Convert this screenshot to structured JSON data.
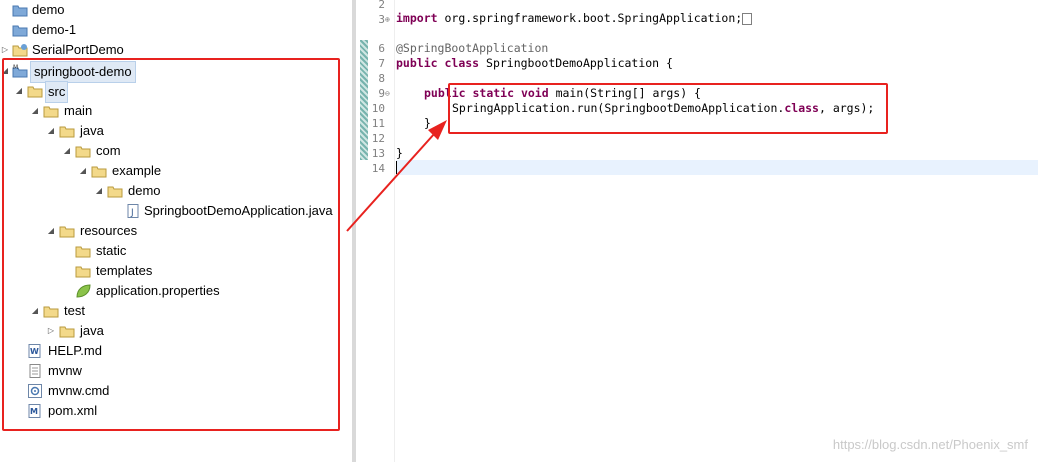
{
  "explorer": {
    "items": [
      {
        "label": "demo",
        "icon": "project-icon"
      },
      {
        "label": "demo-1",
        "icon": "project-icon"
      },
      {
        "label": "SerialPortDemo",
        "icon": "project-icon"
      },
      {
        "label": "springboot-demo",
        "icon": "maven-project-icon"
      },
      {
        "label": "src",
        "icon": "folder-icon"
      },
      {
        "label": "main",
        "icon": "folder-icon"
      },
      {
        "label": "java",
        "icon": "folder-icon"
      },
      {
        "label": "com",
        "icon": "folder-icon"
      },
      {
        "label": "example",
        "icon": "folder-icon"
      },
      {
        "label": "demo",
        "icon": "folder-icon"
      },
      {
        "label": "SpringbootDemoApplication.java",
        "icon": "java-file-icon"
      },
      {
        "label": "resources",
        "icon": "folder-icon"
      },
      {
        "label": "static",
        "icon": "folder-icon"
      },
      {
        "label": "templates",
        "icon": "folder-icon"
      },
      {
        "label": "application.properties",
        "icon": "properties-file-icon"
      },
      {
        "label": "test",
        "icon": "folder-icon"
      },
      {
        "label": "java",
        "icon": "folder-icon"
      },
      {
        "label": "HELP.md",
        "icon": "markdown-file-icon"
      },
      {
        "label": "mvnw",
        "icon": "text-file-icon"
      },
      {
        "label": "mvnw.cmd",
        "icon": "cmd-file-icon"
      },
      {
        "label": "pom.xml",
        "icon": "maven-pom-icon"
      }
    ]
  },
  "editor": {
    "line_numbers": [
      "2",
      "3",
      "6",
      "7",
      "8",
      "9",
      "10",
      "11",
      "12",
      "13",
      "14"
    ],
    "lines": {
      "l3_kw": "import",
      "l3_rest": " org.springframework.boot.SpringApplication;",
      "l6": "@SpringBootApplication",
      "l7_kw1": "public",
      "l7_kw2": " class",
      "l7_rest": " SpringbootDemoApplication {",
      "l9_kw1": "public",
      "l9_kw2": " static",
      "l9_kw3": " void",
      "l9_rest": " main(String[] args) {",
      "l10_a": "SpringApplication.run(SpringbootDemoApplication.",
      "l10_kw": "class",
      "l10_b": ", args);",
      "l11": "}",
      "l13": "}"
    }
  },
  "colors": {
    "annotation_red": "#e8221f",
    "keyword": "#7f0055"
  },
  "watermark": "https://blog.csdn.net/Phoenix_smf"
}
